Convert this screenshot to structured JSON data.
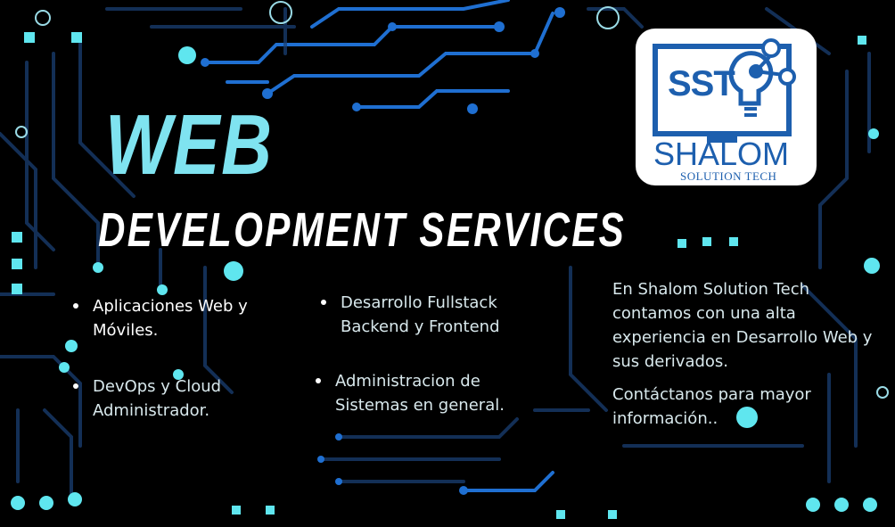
{
  "title": {
    "line1": "WEB",
    "line2": "DEVELOPMENT SERVICES"
  },
  "services": [
    {
      "label": "Aplicaciones Web y Móviles."
    },
    {
      "label": "DevOps y Cloud Administrador."
    },
    {
      "label": "Desarrollo Fullstack Backend y Frontend"
    },
    {
      "label": "Administracion de Sistemas en general."
    }
  ],
  "info": {
    "paragraph1": "En Shalom Solution Tech contamos con una alta experiencia en Desarrollo Web y sus derivados.",
    "paragraph2": "Contáctanos para mayor información.."
  },
  "logo": {
    "abbr": "SST",
    "name": "SHALOM",
    "subtitle": "SOLUTION TECH",
    "color": "#1d5fae"
  },
  "colors": {
    "background": "#000000",
    "circuit": "#1f6fd1",
    "node": "#5fe6ef",
    "title_accent": "#7fe3f0"
  }
}
